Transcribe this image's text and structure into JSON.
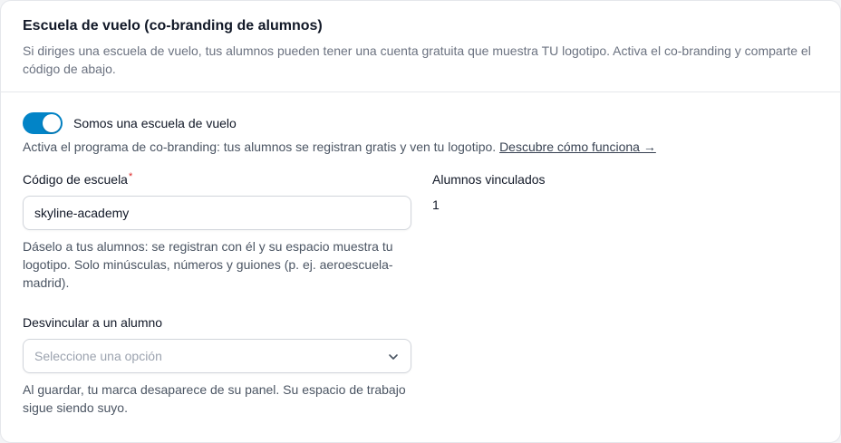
{
  "section": {
    "title": "Escuela de vuelo (co-branding de alumnos)",
    "description": "Si diriges una escuela de vuelo, tus alumnos pueden tener una cuenta gratuita que muestra TU logotipo. Activa el co-branding y comparte el código de abajo."
  },
  "toggle": {
    "label": "Somos una escuela de vuelo",
    "checked": true,
    "help_text": "Activa el programa de co-branding: tus alumnos se registran gratis y ven tu logotipo.",
    "help_link": "Descubre cómo funciona →"
  },
  "school_code": {
    "label": "Código de escuela",
    "required_mark": "*",
    "value": "skyline-academy",
    "help": "Dáselo a tus alumnos: se registran con él y su espacio muestra tu logotipo. Solo minúsculas, números y guiones (p. ej. aeroescuela-madrid)."
  },
  "unlink_student": {
    "label": "Desvincular a un alumno",
    "placeholder": "Seleccione una opción",
    "help": "Al guardar, tu marca desaparece de su panel. Su espacio de trabajo sigue siendo suyo."
  },
  "linked_students": {
    "label": "Alumnos vinculados",
    "count": "1"
  },
  "colors": {
    "accent": "#0284c7",
    "required": "#dc2626"
  }
}
